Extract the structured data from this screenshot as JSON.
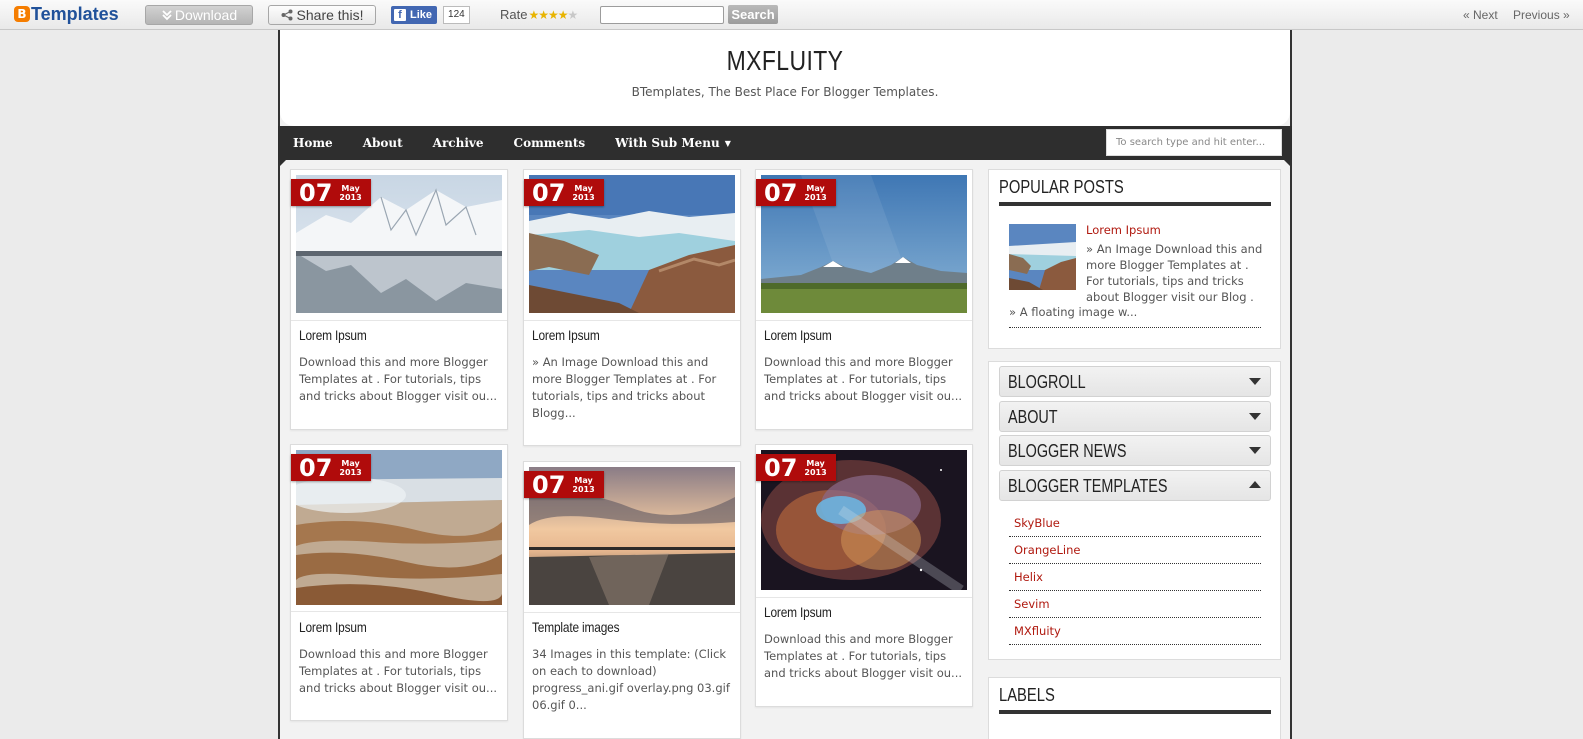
{
  "topbar": {
    "logo_letter": "B",
    "logo_text": "Templates",
    "download_label": "Download",
    "share_label": "Share this!",
    "fb_like_label": "Like",
    "fb_like_count": "124",
    "rate_label": "Rate",
    "rating": 4,
    "rating_max": 5,
    "search_value": "",
    "search_button": "Search",
    "next_label": "« Next",
    "previous_label": "Previous »"
  },
  "header": {
    "title": "MXFLUITY",
    "description": "BTemplates, The Best Place For Blogger Templates."
  },
  "nav": {
    "items": [
      "Home",
      "About",
      "Archive",
      "Comments",
      "With Sub Menu"
    ],
    "search_placeholder": "To search type and hit enter..."
  },
  "posts": [
    {
      "day": "07",
      "month": "May",
      "year": "2013",
      "title": "Lorem Ipsum",
      "excerpt": "Download this and more Blogger Templates at . For tutorials, tips and tricks about Blogger visit ou...",
      "image": "snowy-mountain-lake"
    },
    {
      "day": "07",
      "month": "May",
      "year": "2013",
      "title": "Lorem Ipsum",
      "excerpt": "» An Image Download this and more Blogger Templates at . For tutorials, tips and tricks about Blogg...",
      "image": "glacier-valley"
    },
    {
      "day": "07",
      "month": "May",
      "year": "2013",
      "title": "Lorem Ipsum",
      "excerpt": "Download this and more Blogger Templates at . For tutorials, tips and tricks about Blogger visit ou...",
      "image": "volcano-field"
    },
    {
      "day": "07",
      "month": "May",
      "year": "2013",
      "title": "Lorem Ipsum",
      "excerpt": "Download this and more Blogger Templates at . For tutorials, tips and tricks about Blogger visit ou...",
      "image": "hot-springs-terraces"
    },
    {
      "day": "07",
      "month": "May",
      "year": "2013",
      "title": "Template images",
      "excerpt": "34 Images in this template: (Click on each to download) progress_ani.gif overlay.png 03.gif 06.gif 0...",
      "image": "beach-sunset"
    },
    {
      "day": "07",
      "month": "May",
      "year": "2013",
      "title": "Lorem Ipsum",
      "excerpt": "Download this and more Blogger Templates at . For tutorials, tips and tricks about Blogger visit ou...",
      "image": "nebula"
    }
  ],
  "sidebar": {
    "popular": {
      "title": "POPULAR POSTS",
      "post_title": "Lorem Ipsum",
      "post_excerpt": "» An Image Download this and more Blogger Templates at . For tutorials, tips and tricks about Blogger visit our Blog .",
      "post_excerpt_2": "» A floating image w..."
    },
    "accordion": [
      {
        "title": "BLOGROLL",
        "open": false
      },
      {
        "title": "ABOUT",
        "open": false
      },
      {
        "title": "BLOGGER NEWS",
        "open": false
      },
      {
        "title": "BLOGGER TEMPLATES",
        "open": true
      }
    ],
    "template_links": [
      "SkyBlue",
      "OrangeLine",
      "Helix",
      "Sevim",
      "MXfluity"
    ],
    "labels_title": "LABELS"
  }
}
